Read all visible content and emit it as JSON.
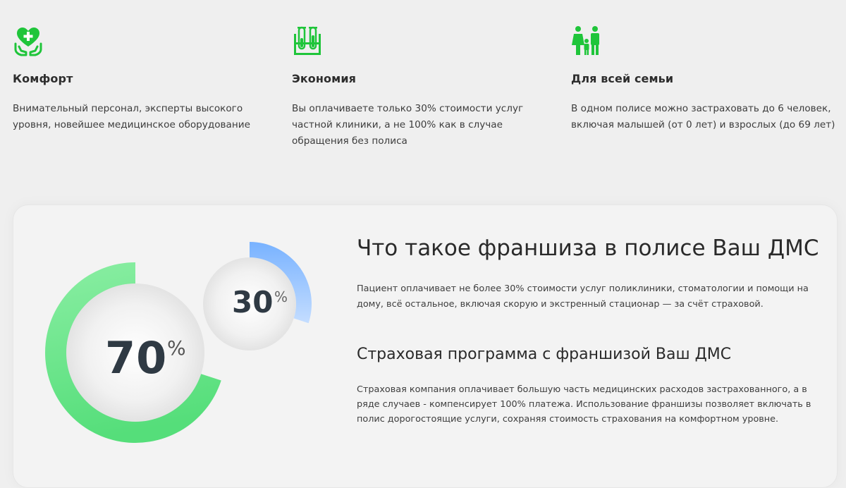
{
  "features": [
    {
      "title": "Комфорт",
      "text": "Внимательный персонал, эксперты высокого уровня, новейшее медицинское оборудование",
      "icon": "heart-hands-icon"
    },
    {
      "title": "Экономия",
      "text": "Вы оплачиваете только 30% стоимости услуг частной клиники, а не 100% как в случае обращения без полиса",
      "icon": "test-tubes-icon"
    },
    {
      "title": "Для всей семьи",
      "text": "В одном полисе можно застраховать до 6 человек, включая малышей (от 0 лет) и взрослых (до 69 лет)",
      "icon": "family-icon"
    }
  ],
  "franchise": {
    "big_value": "70",
    "small_value": "30",
    "percent_sign": "%",
    "big_fraction": 0.7,
    "small_fraction": 0.3,
    "title": "Что такое франшиза в полисе Ваш ДМС",
    "paragraph1": "Пациент оплачивает не более 30% стоимости услуг поликлиники, стоматологии и помощи на дому, всё остальное, включая скорую и экстренный стационар — за счёт страховой.",
    "subtitle": "Страховая программа с франшизой Ваш ДМС",
    "paragraph2": "Страховая компания оплачивает большую часть медицинских расходов застрахованного, а в ряде случаев - компенсирует 100% платежа. Использование франшизы позволяет включать в полис дорогостоящие услуги, сохраняя стоимость страхования на комфортном уровне."
  },
  "colors": {
    "icon_green": "#1fc53a",
    "ring_green": "#5be07f",
    "ring_blue": "#7cb6ff",
    "background": "#efefef"
  }
}
